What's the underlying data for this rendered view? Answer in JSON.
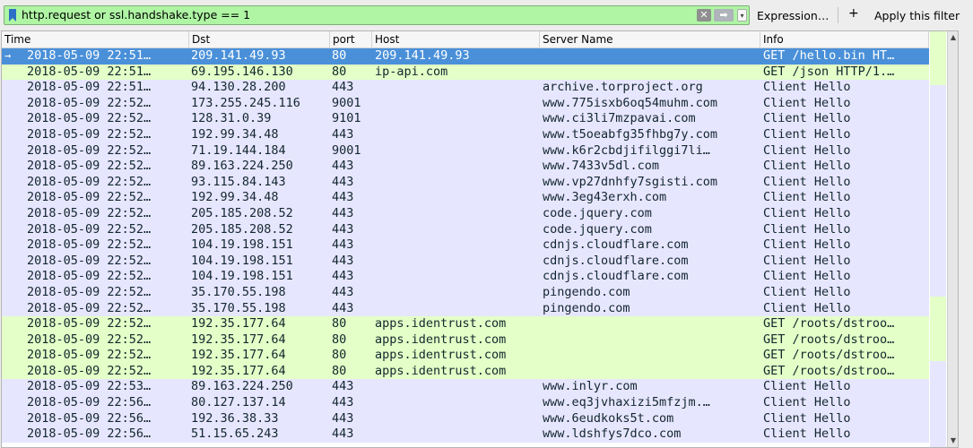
{
  "filter": {
    "text": "http.request or ssl.handshake.type == 1",
    "clear_glyph": "✕",
    "apply_glyph": "➡",
    "dropdown_glyph": "▾",
    "expression_label": "Expression…",
    "plus_glyph": "+",
    "apply_label": "Apply this filter"
  },
  "columns": [
    "Time",
    "Dst",
    "port",
    "Host",
    "Server Name",
    "Info"
  ],
  "icons": {
    "bookmark": "bookmark-icon",
    "clear": "clear-icon",
    "related_packet": "related-packet-icon"
  },
  "colors": {
    "tcp_row": "#e7e6ff",
    "http_row": "#e4ffc7",
    "selected": "#4a90d9",
    "filter_valid": "#aff5a4"
  },
  "rows": [
    {
      "time": "2018-05-09 22:51…",
      "dst": "209.141.49.93",
      "port": "80",
      "host": "209.141.49.93",
      "server": "",
      "info": "GET /hello.bin HT…",
      "kind": "selected",
      "marker": "→"
    },
    {
      "time": "2018-05-09 22:51…",
      "dst": "69.195.146.130",
      "port": "80",
      "host": "ip-api.com",
      "server": "",
      "info": "GET /json HTTP/1.…",
      "kind": "http"
    },
    {
      "time": "2018-05-09 22:51…",
      "dst": "94.130.28.200",
      "port": "443",
      "host": "",
      "server": "archive.torproject.org",
      "info": "Client Hello",
      "kind": "tcp"
    },
    {
      "time": "2018-05-09 22:52…",
      "dst": "173.255.245.116",
      "port": "9001",
      "host": "",
      "server": "www.775isxb6oq54muhm.com",
      "info": "Client Hello",
      "kind": "tcp"
    },
    {
      "time": "2018-05-09 22:52…",
      "dst": "128.31.0.39",
      "port": "9101",
      "host": "",
      "server": "www.ci3li7mzpavai.com",
      "info": "Client Hello",
      "kind": "tcp"
    },
    {
      "time": "2018-05-09 22:52…",
      "dst": "192.99.34.48",
      "port": "443",
      "host": "",
      "server": "www.t5oeabfg35fhbg7y.com",
      "info": "Client Hello",
      "kind": "tcp"
    },
    {
      "time": "2018-05-09 22:52…",
      "dst": "71.19.144.184",
      "port": "9001",
      "host": "",
      "server": "www.k6r2cbdjifilggi7li…",
      "info": "Client Hello",
      "kind": "tcp"
    },
    {
      "time": "2018-05-09 22:52…",
      "dst": "89.163.224.250",
      "port": "443",
      "host": "",
      "server": "www.7433v5dl.com",
      "info": "Client Hello",
      "kind": "tcp"
    },
    {
      "time": "2018-05-09 22:52…",
      "dst": "93.115.84.143",
      "port": "443",
      "host": "",
      "server": "www.vp27dnhfy7sgisti.com",
      "info": "Client Hello",
      "kind": "tcp"
    },
    {
      "time": "2018-05-09 22:52…",
      "dst": "192.99.34.48",
      "port": "443",
      "host": "",
      "server": "www.3eg43erxh.com",
      "info": "Client Hello",
      "kind": "tcp"
    },
    {
      "time": "2018-05-09 22:52…",
      "dst": "205.185.208.52",
      "port": "443",
      "host": "",
      "server": "code.jquery.com",
      "info": "Client Hello",
      "kind": "tcp"
    },
    {
      "time": "2018-05-09 22:52…",
      "dst": "205.185.208.52",
      "port": "443",
      "host": "",
      "server": "code.jquery.com",
      "info": "Client Hello",
      "kind": "tcp"
    },
    {
      "time": "2018-05-09 22:52…",
      "dst": "104.19.198.151",
      "port": "443",
      "host": "",
      "server": "cdnjs.cloudflare.com",
      "info": "Client Hello",
      "kind": "tcp"
    },
    {
      "time": "2018-05-09 22:52…",
      "dst": "104.19.198.151",
      "port": "443",
      "host": "",
      "server": "cdnjs.cloudflare.com",
      "info": "Client Hello",
      "kind": "tcp"
    },
    {
      "time": "2018-05-09 22:52…",
      "dst": "104.19.198.151",
      "port": "443",
      "host": "",
      "server": "cdnjs.cloudflare.com",
      "info": "Client Hello",
      "kind": "tcp"
    },
    {
      "time": "2018-05-09 22:52…",
      "dst": "35.170.55.198",
      "port": "443",
      "host": "",
      "server": "pingendo.com",
      "info": "Client Hello",
      "kind": "tcp"
    },
    {
      "time": "2018-05-09 22:52…",
      "dst": "35.170.55.198",
      "port": "443",
      "host": "",
      "server": "pingendo.com",
      "info": "Client Hello",
      "kind": "tcp"
    },
    {
      "time": "2018-05-09 22:52…",
      "dst": "192.35.177.64",
      "port": "80",
      "host": "apps.identrust.com",
      "server": "",
      "info": "GET /roots/dstroo…",
      "kind": "http"
    },
    {
      "time": "2018-05-09 22:52…",
      "dst": "192.35.177.64",
      "port": "80",
      "host": "apps.identrust.com",
      "server": "",
      "info": "GET /roots/dstroo…",
      "kind": "http"
    },
    {
      "time": "2018-05-09 22:52…",
      "dst": "192.35.177.64",
      "port": "80",
      "host": "apps.identrust.com",
      "server": "",
      "info": "GET /roots/dstroo…",
      "kind": "http"
    },
    {
      "time": "2018-05-09 22:52…",
      "dst": "192.35.177.64",
      "port": "80",
      "host": "apps.identrust.com",
      "server": "",
      "info": "GET /roots/dstroo…",
      "kind": "http"
    },
    {
      "time": "2018-05-09 22:53…",
      "dst": "89.163.224.250",
      "port": "443",
      "host": "",
      "server": "www.inlyr.com",
      "info": "Client Hello",
      "kind": "tcp"
    },
    {
      "time": "2018-05-09 22:56…",
      "dst": "80.127.137.14",
      "port": "443",
      "host": "",
      "server": "www.eq3jvhaxizi5mfzjm.…",
      "info": "Client Hello",
      "kind": "tcp"
    },
    {
      "time": "2018-05-09 22:56…",
      "dst": "192.36.38.33",
      "port": "443",
      "host": "",
      "server": "www.6eudkoks5t.com",
      "info": "Client Hello",
      "kind": "tcp"
    },
    {
      "time": "2018-05-09 22:56…",
      "dst": "51.15.65.243",
      "port": "443",
      "host": "",
      "server": "www.ldshfys7dco.com",
      "info": "Client Hello",
      "kind": "tcp"
    }
  ]
}
